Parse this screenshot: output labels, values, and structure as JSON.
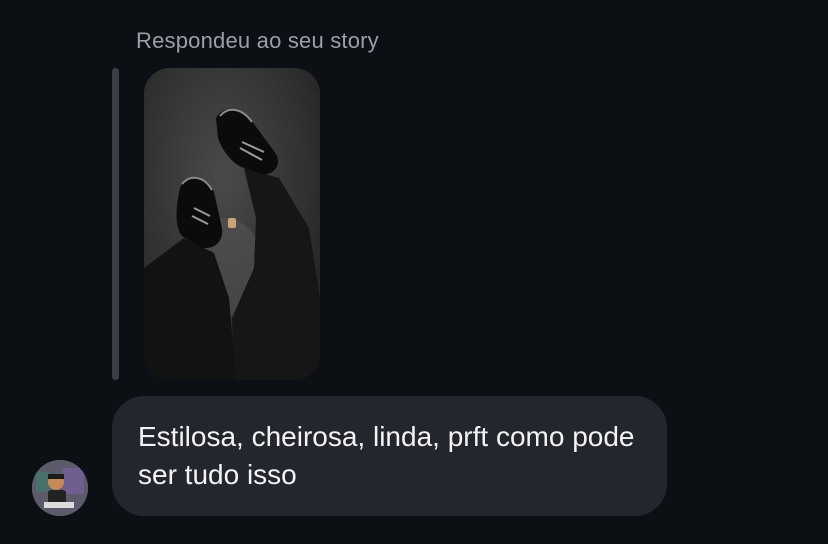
{
  "reply": {
    "label": "Respondeu ao seu story"
  },
  "story": {
    "image_alt": "black and white photo of black sneakers and dark pants on asphalt"
  },
  "message": {
    "text": "Estilosa, cheirosa, linda, prft como pode ser tudo isso"
  },
  "avatar": {
    "description": "cartoon character sitting"
  },
  "colors": {
    "background": "#0c0f14",
    "bubble": "#23262c",
    "label": "#9aa0a8",
    "reply_bar": "#3a3e45",
    "text": "#f2f3f5"
  }
}
